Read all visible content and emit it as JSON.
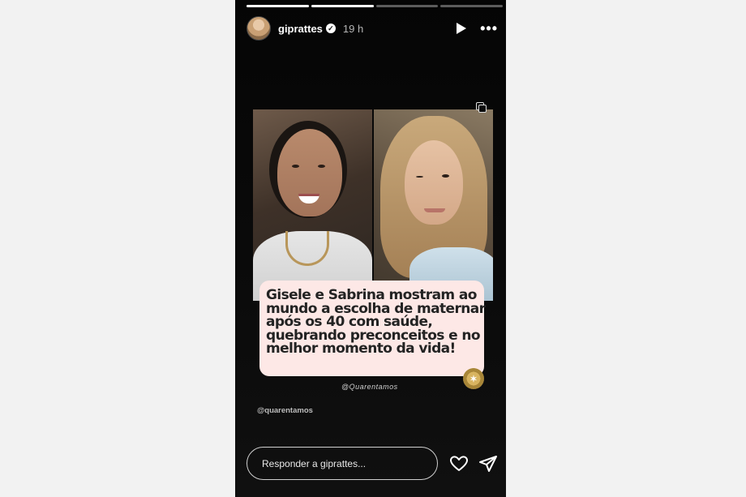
{
  "story": {
    "progress": [
      1.0,
      1.0,
      0.0,
      0.0
    ],
    "header": {
      "username": "giprattes",
      "time": "19 h",
      "icons": [
        "avatar",
        "verified-badge-icon",
        "play-icon",
        "more-icon"
      ]
    },
    "post": {
      "caption_lines": [
        "Gisele e Sabrina mostram ao",
        "mundo a escolha de maternar",
        "após os 40 com saúde,",
        "quebrando preconceitos e no",
        "melhor momento da vida!"
      ],
      "brand_handle": "@Quarentamos"
    },
    "mention": "@quarentamos",
    "reply_placeholder": "Responder a giprattes...",
    "colors": {
      "caption_bg": "#fde8e6",
      "story_bg": "#0a0a0a",
      "page_bg": "#f2f2f2"
    }
  }
}
